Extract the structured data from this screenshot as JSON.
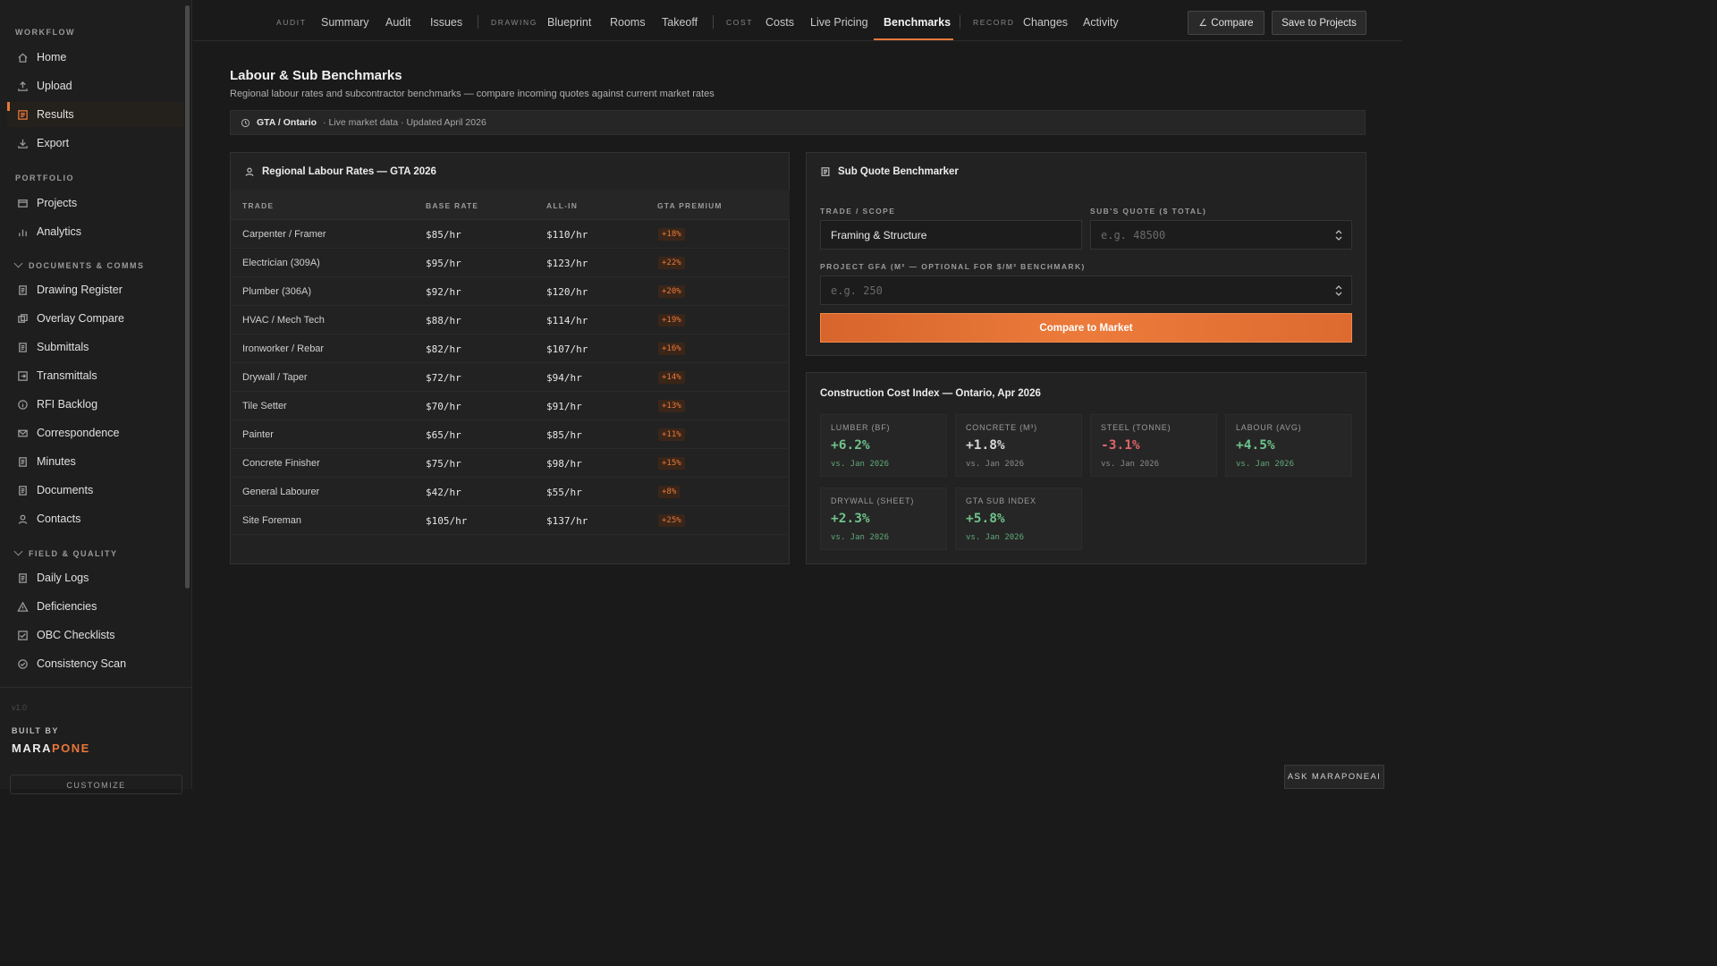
{
  "sidebar": {
    "sections": {
      "workflow": "WORKFLOW",
      "portfolio": "PORTFOLIO",
      "docs": "DOCUMENTS & COMMS",
      "field": "FIELD & QUALITY"
    },
    "workflow_items": [
      "Home",
      "Upload",
      "Results",
      "Export"
    ],
    "portfolio_items": [
      "Projects",
      "Analytics"
    ],
    "docs_items": [
      "Drawing Register",
      "Overlay Compare",
      "Submittals",
      "Transmittals",
      "RFI Backlog",
      "Correspondence",
      "Minutes",
      "Documents",
      "Contacts"
    ],
    "field_items": [
      "Daily Logs",
      "Deficiencies",
      "OBC Checklists",
      "Consistency Scan"
    ],
    "version": "v1.0",
    "built_by": "BUILT BY",
    "brand_a": "MARA",
    "brand_b": "PONE",
    "customize": "CUSTOMIZE"
  },
  "topnav": {
    "groups": [
      "AUDIT",
      "DRAWING",
      "COST",
      "RECORD"
    ],
    "tabs": [
      "Summary",
      "Audit",
      "Issues",
      "Blueprint",
      "Rooms",
      "Takeoff",
      "Costs",
      "Live Pricing",
      "Benchmarks",
      "Changes",
      "Activity"
    ],
    "active_tab": "Benchmarks",
    "compare_button": "Compare",
    "save_button": "Save to Projects"
  },
  "page": {
    "title": "Labour & Sub Benchmarks",
    "subtitle": "Regional labour rates and subcontractor benchmarks — compare incoming quotes against current market rates",
    "region": "GTA / Ontario",
    "region_meta": "· Live market data · Updated April 2026"
  },
  "labour": {
    "title": "Regional Labour Rates — GTA 2026",
    "headers": [
      "TRADE",
      "BASE RATE",
      "ALL-IN",
      "GTA PREMIUM"
    ],
    "rows": [
      [
        "Carpenter / Framer",
        "$85/hr",
        "$110/hr",
        "+18%"
      ],
      [
        "Electrician (309A)",
        "$95/hr",
        "$123/hr",
        "+22%"
      ],
      [
        "Plumber (306A)",
        "$92/hr",
        "$120/hr",
        "+20%"
      ],
      [
        "HVAC / Mech Tech",
        "$88/hr",
        "$114/hr",
        "+19%"
      ],
      [
        "Ironworker / Rebar",
        "$82/hr",
        "$107/hr",
        "+16%"
      ],
      [
        "Drywall / Taper",
        "$72/hr",
        "$94/hr",
        "+14%"
      ],
      [
        "Tile Setter",
        "$70/hr",
        "$91/hr",
        "+13%"
      ],
      [
        "Painter",
        "$65/hr",
        "$85/hr",
        "+11%"
      ],
      [
        "Concrete Finisher",
        "$75/hr",
        "$98/hr",
        "+15%"
      ],
      [
        "General Labourer",
        "$42/hr",
        "$55/hr",
        "+8%"
      ],
      [
        "Site Foreman",
        "$105/hr",
        "$137/hr",
        "+25%"
      ]
    ]
  },
  "benchmarker": {
    "title": "Sub Quote Benchmarker",
    "trade_label": "TRADE / SCOPE",
    "trade_value": "Framing & Structure",
    "quote_label": "SUB'S QUOTE ($ TOTAL)",
    "quote_placeholder": "e.g. 48500",
    "gfa_label": "PROJECT GFA (M² — OPTIONAL FOR $/M² BENCHMARK)",
    "gfa_placeholder": "e.g. 250",
    "cta": "Compare to Market"
  },
  "cci": {
    "title": "Construction Cost Index — Ontario, Apr 2026",
    "cards": [
      {
        "label": "LUMBER (BF)",
        "value": "+6.2%",
        "vs": "vs. Jan 2026",
        "trend": "up"
      },
      {
        "label": "CONCRETE (M³)",
        "value": "+1.8%",
        "vs": "vs. Jan 2026",
        "trend": "flat"
      },
      {
        "label": "STEEL (TONNE)",
        "value": "-3.1%",
        "vs": "vs. Jan 2026",
        "trend": "down"
      },
      {
        "label": "LABOUR (AVG)",
        "value": "+4.5%",
        "vs": "vs. Jan 2026",
        "trend": "up"
      },
      {
        "label": "DRYWALL (SHEET)",
        "value": "+2.3%",
        "vs": "vs. Jan 2026",
        "trend": "up"
      },
      {
        "label": "GTA SUB INDEX",
        "value": "+5.8%",
        "vs": "vs. Jan 2026",
        "trend": "up"
      }
    ]
  },
  "assistant": "ASK MARAPONEAI",
  "colors": {
    "accent": "#e8773a",
    "positive": "#6ec48a",
    "negative": "#e0646a"
  }
}
